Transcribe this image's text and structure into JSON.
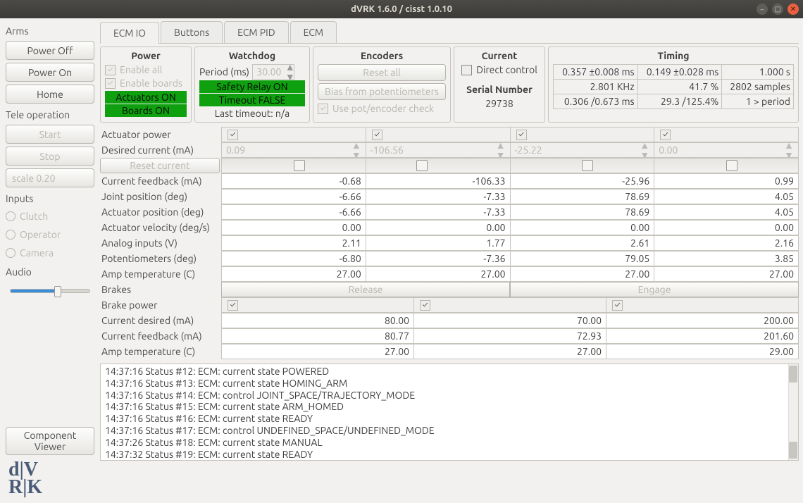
{
  "window": {
    "title": "dVRK 1.6.0 / cisst 1.0.10"
  },
  "sidebar": {
    "arms_label": "Arms",
    "power_off": "Power Off",
    "power_on": "Power On",
    "home": "Home",
    "teleop_label": "Tele operation",
    "start": "Start",
    "stop": "Stop",
    "scale": "scale 0.20",
    "inputs_label": "Inputs",
    "clutch": "Clutch",
    "operator": "Operator",
    "camera": "Camera",
    "audio_label": "Audio",
    "component_viewer": "Component\nViewer"
  },
  "tabs": [
    "ECM IO",
    "Buttons",
    "ECM PID",
    "ECM"
  ],
  "power_panel": {
    "title": "Power",
    "enable_all": "Enable all",
    "enable_boards": "Enable boards",
    "actuators_on": "Actuators ON",
    "boards_on": "Boards ON"
  },
  "watchdog_panel": {
    "title": "Watchdog",
    "period_label": "Period (ms)",
    "period_value": "30.00",
    "safety_relay": "Safety Relay ON",
    "timeout": "Timeout FALSE",
    "last_timeout": "Last timeout: n/a"
  },
  "encoders_panel": {
    "title": "Encoders",
    "reset_all": "Reset all",
    "bias": "Bias from potentiometers",
    "use_pot": "Use pot/encoder check"
  },
  "current_panel": {
    "title": "Current",
    "direct": "Direct control",
    "serial_label": "Serial Number",
    "serial_value": "29738"
  },
  "timing_panel": {
    "title": "Timing",
    "rows": [
      [
        "0.357 ±0.008 ms",
        "0.149 ±0.028 ms",
        "1.000 s"
      ],
      [
        "2.801  KHz",
        "41.7 %",
        "2802 samples"
      ],
      [
        "0.306 /0.673 ms",
        "29.3 /125.4%",
        "1 > period"
      ]
    ]
  },
  "rows": {
    "actuator_power": "Actuator power",
    "desired_current": "Desired current (mA)",
    "desired_values": [
      "0.09",
      "-106.56",
      "-25.22",
      "0.00"
    ],
    "reset_current": "Reset current",
    "slider_pos": [
      50,
      35,
      50,
      50
    ],
    "current_feedback": "Current feedback (mA)",
    "current_feedback_v": [
      "-0.68",
      "-106.33",
      "-25.96",
      "0.99"
    ],
    "joint_pos": "Joint position (deg)",
    "joint_pos_v": [
      "-6.66",
      "-7.33",
      "78.69",
      "4.05"
    ],
    "actuator_pos": "Actuator position (deg)",
    "actuator_pos_v": [
      "-6.66",
      "-7.33",
      "78.69",
      "4.05"
    ],
    "actuator_vel": "Actuator velocity (deg/s)",
    "actuator_vel_v": [
      "0.00",
      "0.00",
      "0.00",
      "0.00"
    ],
    "analog_in": "Analog inputs (V)",
    "analog_in_v": [
      "2.11",
      "1.77",
      "2.61",
      "2.16"
    ],
    "pot": "Potentiometers (deg)",
    "pot_v": [
      "-6.80",
      "-7.36",
      "79.05",
      "3.85"
    ],
    "amp_temp": "Amp temperature (C)",
    "amp_temp_v": [
      "27.00",
      "27.00",
      "27.00",
      "27.00"
    ],
    "brakes": "Brakes",
    "release": "Release",
    "engage": "Engage",
    "brake_power": "Brake power",
    "curr_desired": "Current desired (mA)",
    "curr_desired_v": [
      "80.00",
      "70.00",
      "200.00"
    ],
    "curr_feedback2": "Current feedback (mA)",
    "curr_feedback2_v": [
      "80.77",
      "72.93",
      "201.60"
    ],
    "amp_temp2": "Amp temperature (C)",
    "amp_temp2_v": [
      "27.00",
      "27.00",
      "29.00"
    ]
  },
  "log": [
    "14:37:16 Status #12: ECM: current state POWERED",
    "14:37:16 Status #13: ECM: current state HOMING_ARM",
    "14:37:16 Status #14: ECM: control JOINT_SPACE/TRAJECTORY_MODE",
    "14:37:16 Status #15: ECM: current state ARM_HOMED",
    "14:37:16 Status #16: ECM: current state READY",
    "14:37:16 Status #17: ECM: control UNDEFINED_SPACE/UNDEFINED_MODE",
    "14:37:26 Status #18: ECM: current state MANUAL",
    "14:37:32 Status #19: ECM: current state READY"
  ]
}
